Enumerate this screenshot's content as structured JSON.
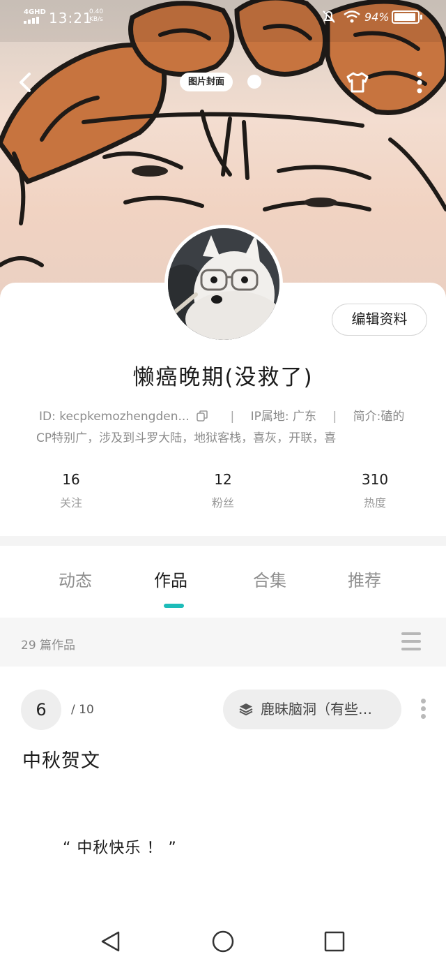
{
  "status_bar": {
    "network": "4GHD",
    "time": "13:21",
    "speed_value": "0.40",
    "speed_unit": "KB/s",
    "battery_percent": "94%",
    "battery_level": 0.94
  },
  "cover": {
    "tag_label": "图片封面"
  },
  "profile": {
    "edit_button": "编辑资料",
    "nickname": "懒癌晚期(没救了)",
    "id_text": "ID: kecpkemozhengden...",
    "ip_text": "IP属地: 广东",
    "bio_line1": "简介:磕的",
    "bio_line2": "CP特别广，涉及到斗罗大陆，地狱客栈，喜灰，开联，喜"
  },
  "stats": [
    {
      "value": "16",
      "label": "关注"
    },
    {
      "value": "12",
      "label": "粉丝"
    },
    {
      "value": "310",
      "label": "热度"
    }
  ],
  "tabs": [
    {
      "label": "动态",
      "active": false
    },
    {
      "label": "作品",
      "active": true
    },
    {
      "label": "合集",
      "active": false
    },
    {
      "label": "推荐",
      "active": false
    }
  ],
  "works": {
    "count_text": "29 篇作品"
  },
  "work_item": {
    "rank": "6",
    "rank_total": "/ 10",
    "collection": "鹿昧脑洞（有些…",
    "title": "中秋贺文",
    "excerpt": "“ 中秋快乐 ！ ”"
  },
  "icons": {
    "back": "chevron-left-icon",
    "skin": "tshirt-icon",
    "more": "more-vertical-icon",
    "copy": "copy-icon",
    "list": "menu-icon",
    "layers": "layers-icon"
  },
  "colors": {
    "accent": "#1dbcb9",
    "muted_text": "#8b8b8b",
    "pill_bg": "#eeeeee"
  }
}
